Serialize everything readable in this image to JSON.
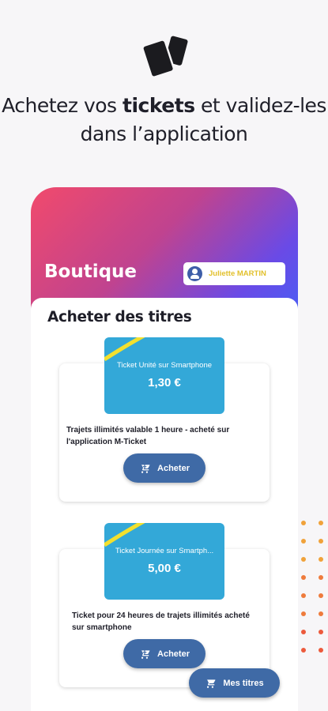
{
  "hero": {
    "title_part1": "Achetez vos ",
    "title_bold": "tickets",
    "title_part2": " et validez-les",
    "title_line2": "dans l’application",
    "icon": "tickets-icon"
  },
  "header": {
    "title": "Boutique",
    "user_name": "Juliette MARTIN"
  },
  "main": {
    "section_title": "Acheter des titres",
    "products": [
      {
        "ticket_name": "Ticket Unité sur Smartphone",
        "price": "1,30 €",
        "description": "Trajets illimités valable 1 heure - acheté sur l'application M-Ticket",
        "buy_label": "Acheter"
      },
      {
        "ticket_name": "Ticket Journée sur Smartph...",
        "price": "5,00 €",
        "description": "Ticket pour 24 heures de trajets illimités acheté sur smartphone",
        "buy_label": "Acheter"
      }
    ]
  },
  "fab": {
    "label": "Mes titres",
    "icon": "cart-icon"
  },
  "colors": {
    "gradient_start": "#f14a6c",
    "gradient_end": "#4b5cf3",
    "button": "#3f6aa6",
    "ticket": "#33a8d8",
    "user_name": "#e2c02c"
  }
}
